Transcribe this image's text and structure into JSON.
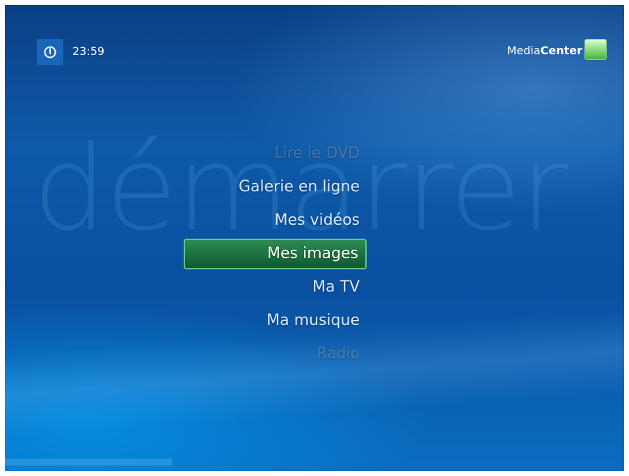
{
  "header": {
    "time": "23:59",
    "brand": {
      "light": "Media",
      "bold": "Center"
    }
  },
  "background_word": "démarrer",
  "menu": {
    "items": [
      {
        "label": "Lire le DVD",
        "state": "faded"
      },
      {
        "label": "Galerie en ligne",
        "state": "normal"
      },
      {
        "label": "Mes vidéos",
        "state": "normal"
      },
      {
        "label": "Mes images",
        "state": "selected"
      },
      {
        "label": "Ma TV",
        "state": "normal"
      },
      {
        "label": "Ma musique",
        "state": "normal"
      },
      {
        "label": "Radio",
        "state": "faded"
      }
    ]
  },
  "colors": {
    "background": "#0e5aa8",
    "selection": "#1f7a45",
    "selection_border": "#61c48a"
  },
  "icons": {
    "power": "power-icon",
    "windows": "windows-logo-icon"
  }
}
